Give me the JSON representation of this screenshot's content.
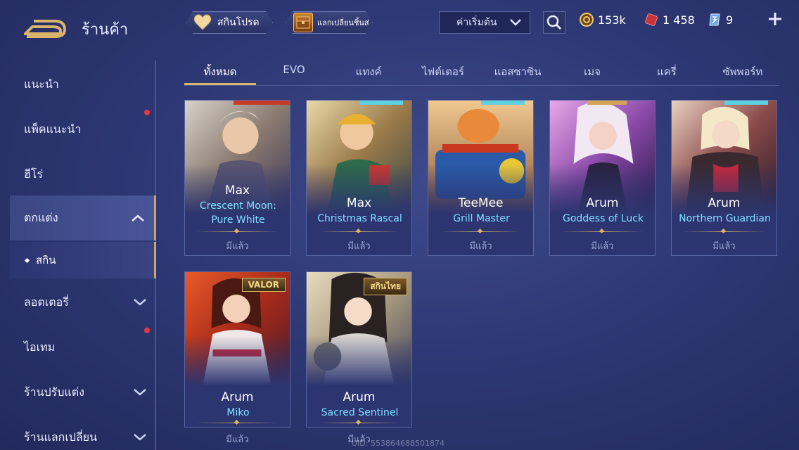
{
  "header": {
    "title": "ร้านค้า",
    "favorite_label": "สกินโปรด",
    "exchange_label": "แลกเปลี่ยนชิ้นส่",
    "sort_label": "ค่าเริ่มต้น",
    "currencies": [
      {
        "icon": "gold-coin-icon",
        "value": "153k"
      },
      {
        "icon": "red-voucher-icon",
        "value": "1 458"
      },
      {
        "icon": "skin-token-icon",
        "value": "9"
      }
    ]
  },
  "sidebar": {
    "items": [
      {
        "label": "แนะนำ"
      },
      {
        "label": "แพ็คแนะนำ"
      },
      {
        "label": "ฮีโร่"
      },
      {
        "label": "ตกแต่ง"
      },
      {
        "label": "สกิน"
      },
      {
        "label": "ลอตเตอรี่"
      },
      {
        "label": "ไอเทม"
      },
      {
        "label": "ร้านปรับแต่ง"
      },
      {
        "label": "ร้านแลกเปลี่ยน"
      }
    ]
  },
  "tabs": [
    "ทั้งหมด",
    "EVO",
    "แทงค์",
    "ไฟต์เตอร์",
    "แอสซาซิน",
    "เมจ",
    "แครี่",
    "ซัพพอร์ท"
  ],
  "cards": [
    {
      "hero": "Max",
      "skin_line1": "Crescent Moon:",
      "skin_line2": "Pure White",
      "status": "มีแล้ว",
      "badge": ""
    },
    {
      "hero": "Max",
      "skin_line1": "Christmas Rascal",
      "skin_line2": "",
      "status": "มีแล้ว",
      "badge": ""
    },
    {
      "hero": "TeeMee",
      "skin_line1": "Grill Master",
      "skin_line2": "",
      "status": "มีแล้ว",
      "badge": ""
    },
    {
      "hero": "Arum",
      "skin_line1": "Goddess of Luck",
      "skin_line2": "",
      "status": "มีแล้ว",
      "badge": ""
    },
    {
      "hero": "Arum",
      "skin_line1": "Northern Guardian",
      "skin_line2": "",
      "status": "มีแล้ว",
      "badge": ""
    },
    {
      "hero": "Arum",
      "skin_line1": "Miko",
      "skin_line2": "",
      "status": "มีแล้ว",
      "badge": "VALOR"
    },
    {
      "hero": "Arum",
      "skin_line1": "Sacred Sentinel",
      "skin_line2": "",
      "status": "มีแล้ว",
      "badge": "สกินไทย"
    }
  ],
  "uid_text": "UID: 553864688501874",
  "colors": {
    "accent_gold": "#d9b46a",
    "skin_name": "#7fe0ff",
    "notification": "#e6393f"
  }
}
